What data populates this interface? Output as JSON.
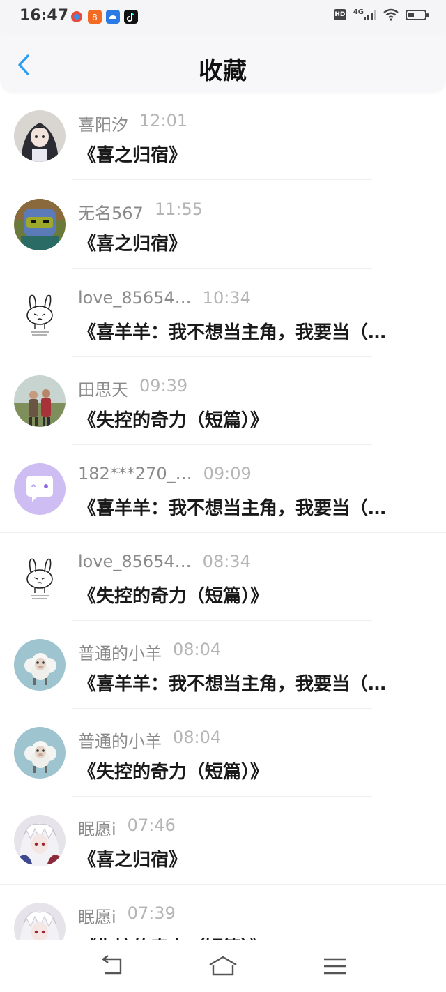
{
  "status_bar": {
    "time": "16:47",
    "network": "4G",
    "icons": [
      "hd-icon",
      "signal-icon",
      "wifi-icon",
      "battery-icon"
    ],
    "battery_level": 0.35
  },
  "header": {
    "title": "收藏",
    "back_icon": "chevron-left-icon",
    "accent_color": "#2f9df0"
  },
  "favorites": [
    {
      "user": "喜阳汐",
      "time": "12:01",
      "title": "《喜之归宿》",
      "avatar": "anime-girl"
    },
    {
      "user": "无名567",
      "time": "11:55",
      "title": "《喜之归宿》",
      "avatar": "lego-ninja"
    },
    {
      "user": "love_85654…",
      "time": "10:34",
      "title": "《喜羊羊：我不想当主角，我要当（…",
      "avatar": "sketch-rabbit"
    },
    {
      "user": "田思天",
      "time": "09:39",
      "title": "《失控的奇力（短篇）》",
      "avatar": "couple-photo"
    },
    {
      "user": "182***270_…",
      "time": "09:09",
      "title": "《喜羊羊：我不想当主角，我要当（…",
      "avatar": "chat-bubble"
    },
    {
      "user": "love_85654…",
      "time": "08:34",
      "title": "《失控的奇力（短篇）》",
      "avatar": "sketch-rabbit"
    },
    {
      "user": "普通的小羊",
      "time": "08:04",
      "title": "《喜羊羊：我不想当主角，我要当（…",
      "avatar": "sheep"
    },
    {
      "user": "普通的小羊",
      "time": "08:04",
      "title": "《失控的奇力（短篇）》",
      "avatar": "sheep"
    },
    {
      "user": "眠愿i",
      "time": "07:46",
      "title": "《喜之归宿》",
      "avatar": "white-hair"
    },
    {
      "user": "眠愿i",
      "time": "07:39",
      "title": "《失控的奇力（短篇）》",
      "avatar": "white-hair"
    }
  ],
  "system_nav": {
    "icons": [
      "back-arrow-icon",
      "home-icon",
      "menu-icon"
    ]
  }
}
